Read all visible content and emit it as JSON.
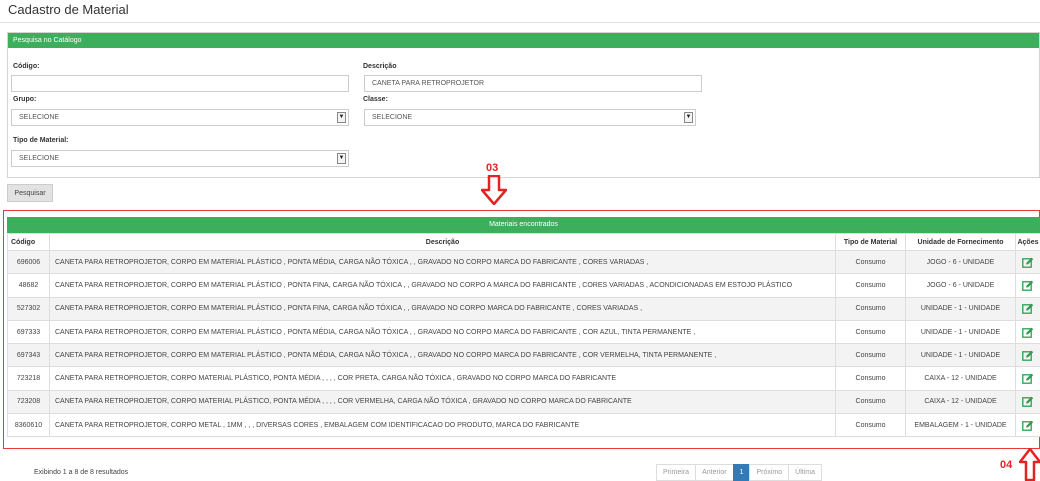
{
  "page": {
    "title": "Cadastro de Material"
  },
  "search_panel": {
    "header": "Pesquisa no Catálogo",
    "codigo": {
      "label": "Código:",
      "value": ""
    },
    "descricao": {
      "label": "Descrição",
      "value": "CANETA PARA RETROPROJETOR"
    },
    "grupo": {
      "label": "Grupo:",
      "selected": "SELECIONE"
    },
    "classe": {
      "label": "Classe:",
      "selected": "SELECIONE"
    },
    "tipo": {
      "label": "Tipo de Material:",
      "selected": "SELECIONE"
    },
    "search_button": "Pesquisar"
  },
  "annotations": {
    "a03": "03",
    "a04": "04",
    "color": "#e52222"
  },
  "results": {
    "header": "Materiais encontrados",
    "columns": [
      "Código",
      "Descrição",
      "Tipo de Material",
      "Unidade de Fornecimento",
      "Ações"
    ],
    "rows": [
      {
        "codigo": "696006",
        "descricao": "CANETA PARA RETROPROJETOR, CORPO EM MATERIAL PLÁSTICO , PONTA MÉDIA, CARGA NÃO TÓXICA , , GRAVADO NO CORPO MARCA DO FABRICANTE , CORES VARIADAS ,",
        "tipo": "Consumo",
        "unidade": "JOGO - 6 - UNIDADE"
      },
      {
        "codigo": "48682",
        "descricao": "CANETA PARA RETROPROJETOR, CORPO EM MATERIAL PLÁSTICO , PONTA FINA, CARGA NÃO TÓXICA , , GRAVADO NO CORPO A MARCA DO FABRICANTE , CORES VARIADAS , ACONDICIONADAS EM ESTOJO PLÁSTICO",
        "tipo": "Consumo",
        "unidade": "JOGO - 6 - UNIDADE"
      },
      {
        "codigo": "527302",
        "descricao": "CANETA PARA RETROPROJETOR, CORPO EM MATERIAL PLÁSTICO , PONTA FINA, CARGA NÃO TÓXICA , , GRAVADO NO CORPO MARCA DO FABRICANTE , CORES VARIADAS ,",
        "tipo": "Consumo",
        "unidade": "UNIDADE - 1 - UNIDADE"
      },
      {
        "codigo": "697333",
        "descricao": "CANETA PARA RETROPROJETOR, CORPO EM MATERIAL PLÁSTICO , PONTA MÉDIA, CARGA NÃO TÓXICA , , GRAVADO NO CORPO MARCA DO FABRICANTE , COR AZUL, TINTA PERMANENTE ,",
        "tipo": "Consumo",
        "unidade": "UNIDADE - 1 - UNIDADE"
      },
      {
        "codigo": "697343",
        "descricao": "CANETA PARA RETROPROJETOR, CORPO EM MATERIAL PLÁSTICO , PONTA MÉDIA, CARGA NÃO TÓXICA , , GRAVADO NO CORPO MARCA DO FABRICANTE , COR VERMELHA, TINTA PERMANENTE ,",
        "tipo": "Consumo",
        "unidade": "UNIDADE - 1 - UNIDADE"
      },
      {
        "codigo": "723218",
        "descricao": "CANETA PARA RETROPROJETOR, CORPO MATERIAL PLÁSTICO, PONTA MÉDIA , , , , COR PRETA, CARGA NÃO TÓXICA , GRAVADO NO CORPO MARCA DO FABRICANTE",
        "tipo": "Consumo",
        "unidade": "CAIXA - 12 - UNIDADE"
      },
      {
        "codigo": "723208",
        "descricao": "CANETA PARA RETROPROJETOR, CORPO MATERIAL PLÁSTICO, PONTA MÉDIA , , , , COR VERMELHA, CARGA NÃO TÓXICA , GRAVADO NO CORPO MARCA DO FABRICANTE",
        "tipo": "Consumo",
        "unidade": "CAIXA - 12 - UNIDADE"
      },
      {
        "codigo": "8360610",
        "descricao": "CANETA PARA RETROPROJETOR, CORPO METAL , 1MM , , , DIVERSAS CORES , EMBALAGEM COM IDENTIFICACAO DO PRODUTO, MARCA DO FABRICANTE",
        "tipo": "Consumo",
        "unidade": "EMBALAGEM - 1 - UNIDADE"
      }
    ],
    "edit_icon": "edit-icon"
  },
  "footer": {
    "count_text": "Exibindo 1 a 8 de 8 resultados",
    "pagination": {
      "first": "Primeira",
      "prev": "Anterior",
      "current": "1",
      "next": "Próximo",
      "last": "Última"
    }
  },
  "colors": {
    "header_green": "#3dae5b",
    "pager_active": "#337ab7",
    "edit_icon": "#2e9e4f"
  }
}
